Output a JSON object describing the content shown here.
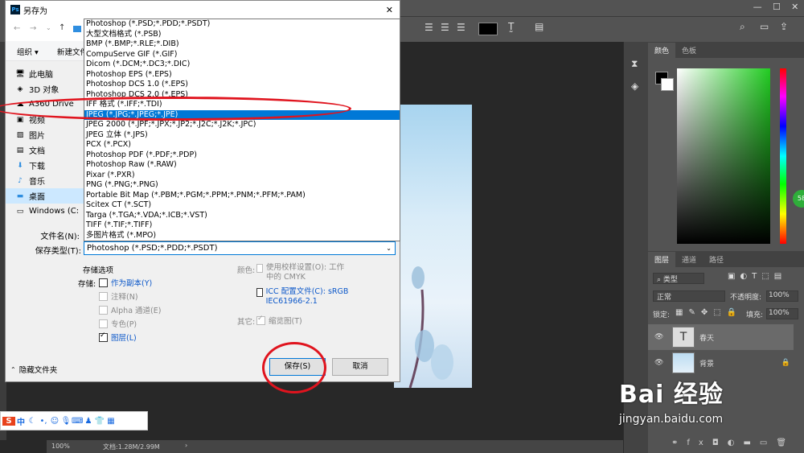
{
  "photoshop": {
    "panel_tabs_color": [
      "颜色",
      "色板"
    ],
    "panel_tabs_layers": [
      "图层",
      "通道",
      "路径"
    ],
    "kind_filter": "类型",
    "blend_mode": "正常",
    "opacity_label": "不透明度:",
    "opacity_value": "100%",
    "lock_label": "锁定:",
    "fill_label": "填充:",
    "fill_value": "100%",
    "layers": [
      {
        "name": "春天",
        "thumb": "T"
      },
      {
        "name": "背景",
        "thumb": ""
      }
    ],
    "zoom": "100%",
    "doc_info": "文档:1.28M/2.99M",
    "green_badge": "58"
  },
  "dialog": {
    "title": "另存为",
    "toolbar": {
      "organize": "组织 ▾",
      "new_folder": "新建文件"
    },
    "sidebar": [
      {
        "label": "此电脑",
        "icon": "computer-icon"
      },
      {
        "label": "3D 对象",
        "icon": "cube-icon"
      },
      {
        "label": "A360 Drive",
        "icon": "cloud-drive-icon"
      },
      {
        "label": "视频",
        "icon": "video-icon"
      },
      {
        "label": "图片",
        "icon": "picture-icon"
      },
      {
        "label": "文档",
        "icon": "document-icon"
      },
      {
        "label": "下载",
        "icon": "download-icon"
      },
      {
        "label": "音乐",
        "icon": "music-icon"
      },
      {
        "label": "桌面",
        "icon": "desktop-icon"
      },
      {
        "label": "Windows (C:",
        "icon": "drive-icon"
      }
    ],
    "filename_label": "文件名(N):",
    "filetype_label": "保存类型(T):",
    "filetype_value": "Photoshop (*.PSD;*.PDD;*.PSDT)",
    "formats": [
      "Photoshop (*.PSD;*.PDD;*.PSDT)",
      "大型文档格式 (*.PSB)",
      "BMP (*.BMP;*.RLE;*.DIB)",
      "CompuServe GIF (*.GIF)",
      "Dicom (*.DCM;*.DC3;*.DIC)",
      "Photoshop EPS (*.EPS)",
      "Photoshop DCS 1.0 (*.EPS)",
      "Photoshop DCS 2.0 (*.EPS)",
      "IFF 格式 (*.IFF;*.TDI)",
      "JPEG (*.JPG;*.JPEG;*.JPE)",
      "JPEG 2000 (*.JPF;*.JPX;*.JP2;*.J2C;*.J2K;*.JPC)",
      "JPEG 立体 (*.JPS)",
      "PCX (*.PCX)",
      "Photoshop PDF (*.PDF;*.PDP)",
      "Photoshop Raw (*.RAW)",
      "Pixar (*.PXR)",
      "PNG (*.PNG;*.PNG)",
      "Portable Bit Map (*.PBM;*.PGM;*.PPM;*.PNM;*.PFM;*.PAM)",
      "Scitex CT (*.SCT)",
      "Targa (*.TGA;*.VDA;*.ICB;*.VST)",
      "TIFF (*.TIF;*.TIFF)",
      "多图片格式 (*.MPO)"
    ],
    "selected_format": "JPEG (*.JPG;*.JPEG;*.JPE)",
    "save_options_title": "存储选项",
    "save_label": "存储:",
    "opt_copy": "作为副本(Y)",
    "opt_notes": "注释(N)",
    "opt_alpha": "Alpha 通道(E)",
    "opt_spot": "专色(P)",
    "opt_layers": "图层(L)",
    "color_label": "颜色:",
    "opt_proof": "使用校样设置(O): 工作中的 CMYK",
    "opt_icc": "ICC 配置文件(C): sRGB IEC61966-2.1",
    "other_label": "其它:",
    "opt_thumb": "缩览图(T)",
    "hide_folders": "隐藏文件夹",
    "save_button": "保存(S)",
    "cancel_button": "取消"
  },
  "ime": {
    "lang": "中"
  },
  "watermark": {
    "brand": "Bai 经验",
    "url": "jingyan.baidu.com"
  }
}
